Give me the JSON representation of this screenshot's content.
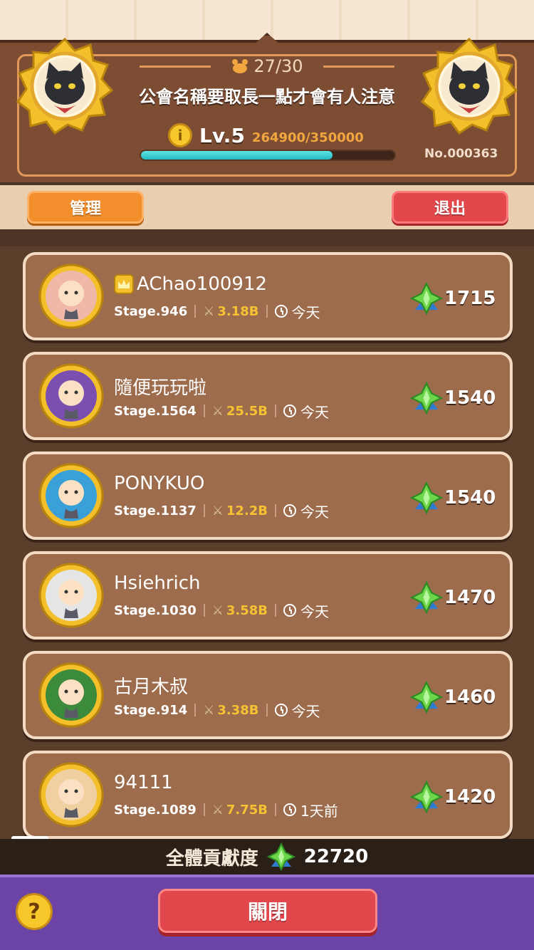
{
  "guild": {
    "members_count": "27/30",
    "name": "公會名稱要取長一點才會有人注意",
    "level": "Lv.5",
    "exp": "264900/350000",
    "exp_fraction": 0.757,
    "number": "No.000363"
  },
  "actions": {
    "manage_label": "管理",
    "exit_label": "退出"
  },
  "members": [
    {
      "name": "AChao100912",
      "leader": true,
      "stage": "Stage.946",
      "power": "3.18B",
      "last_active": "今天",
      "contribution": "1715"
    },
    {
      "name": "隨便玩玩啦",
      "leader": false,
      "stage": "Stage.1564",
      "power": "25.5B",
      "last_active": "今天",
      "contribution": "1540"
    },
    {
      "name": "PONYKUO",
      "leader": false,
      "stage": "Stage.1137",
      "power": "12.2B",
      "last_active": "今天",
      "contribution": "1540"
    },
    {
      "name": "Hsiehrich",
      "leader": false,
      "stage": "Stage.1030",
      "power": "3.58B",
      "last_active": "今天",
      "contribution": "1470"
    },
    {
      "name": "古月木叔",
      "leader": false,
      "stage": "Stage.914",
      "power": "3.38B",
      "last_active": "今天",
      "contribution": "1460"
    },
    {
      "name": "94111",
      "leader": false,
      "stage": "Stage.1089",
      "power": "7.75B",
      "last_active": "1天前",
      "contribution": "1420"
    }
  ],
  "footer": {
    "total_label": "全體貢獻度",
    "total_value": "22720",
    "close_label": "關閉",
    "help_label": "?"
  },
  "colors": {
    "header_bg": "#7c4d33",
    "card_bg": "#9d6c4c",
    "card_border": "#f4dcc4",
    "manage_button": "#f28e2b",
    "exit_button": "#e2484b",
    "exp_fill": "#24b8c0",
    "bottom_bar": "#6b44a6"
  },
  "icons": {
    "emblem": "black-cat-emblem-icon",
    "members": "paw-icon",
    "level": "coin-icon",
    "leader": "crown-icon",
    "power": "sword-icon",
    "last_active": "clock-icon",
    "contribution": "green-clover-icon"
  }
}
